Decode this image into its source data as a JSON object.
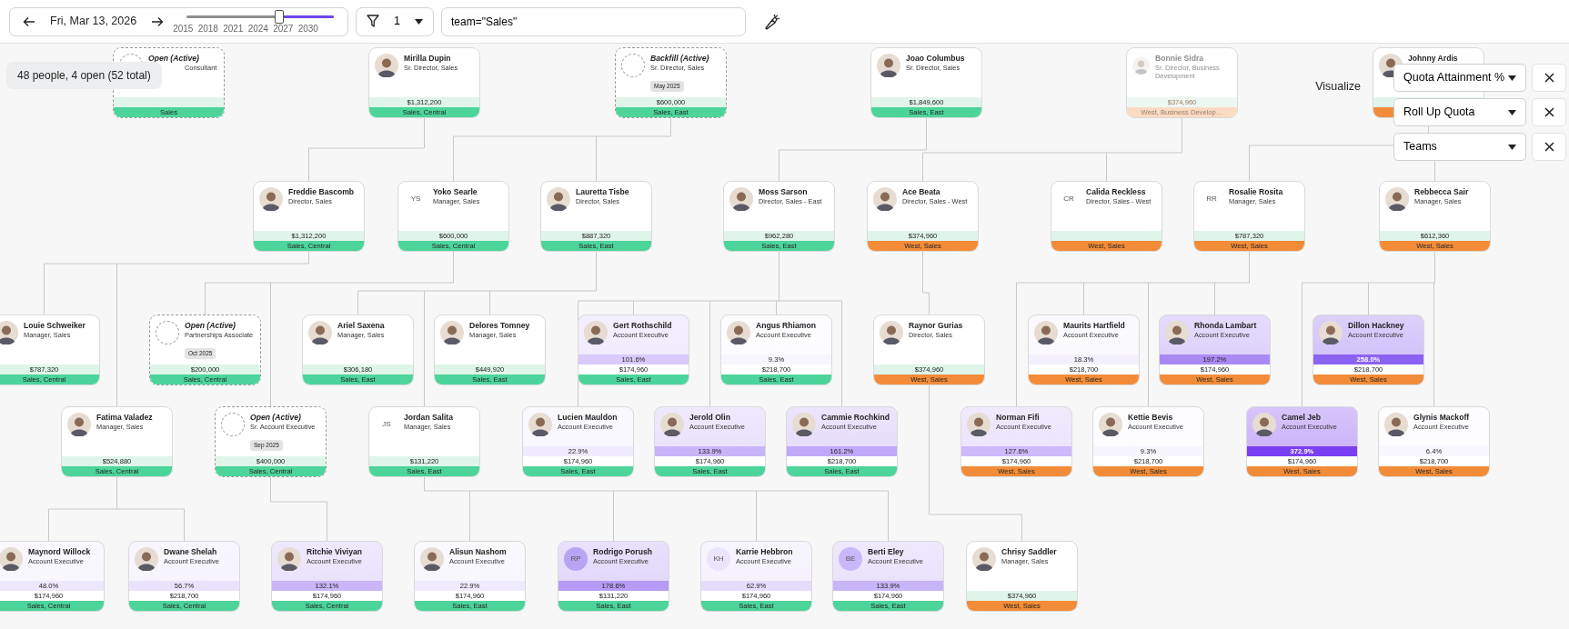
{
  "toolbar": {
    "date": "Fri, Mar 13, 2026",
    "slider": {
      "level": 0.63,
      "years": [
        "2015",
        "2018",
        "2021",
        "2024",
        "2027",
        "2030"
      ]
    },
    "filter": {
      "count": "1"
    },
    "query": {
      "value": "team=\"Sales\""
    }
  },
  "summary": "48 people, 4 open (52 total)",
  "visualize": {
    "label": "Visualize",
    "dropdowns": [
      {
        "label": "Quota Attainment %"
      },
      {
        "label": "Roll Up Quota"
      },
      {
        "label": "Teams"
      }
    ]
  },
  "cards": [
    {
      "kind": "open",
      "name": "Open (Active)",
      "title": "Consultant",
      "avatar": {
        "kind": "empty"
      },
      "team": {
        "text": "Sales",
        "color": "#4cd49b"
      }
    },
    {
      "kind": "person",
      "name": "Mirilla Dupin",
      "title": "Sr. Director, Sales",
      "avatar": {
        "kind": "photo"
      },
      "amount": "$1,312,200",
      "team": {
        "text": "Sales, Central",
        "color": "#4cd49b"
      }
    },
    {
      "kind": "open",
      "name": "Backfill (Active)",
      "title": "Sr. Director, Sales",
      "date": "May 2025",
      "avatar": {
        "kind": "empty"
      },
      "amount": "$600,000",
      "team": {
        "text": "Sales, East",
        "color": "#4cd49b"
      }
    },
    {
      "kind": "person",
      "name": "Joao Columbus",
      "title": "Sr. Director, Sales",
      "avatar": {
        "kind": "photo"
      },
      "amount": "$1,849,600",
      "team": {
        "text": "Sales, East",
        "color": "#4cd49b"
      }
    },
    {
      "kind": "person",
      "name": "Bonnie Sidra",
      "title": "Sr. Director, Business Development",
      "faded": true,
      "avatar": {
        "kind": "photo"
      },
      "amount": "$374,960",
      "team": {
        "text": "West, Business Develop…",
        "color": "#fbdcc3"
      }
    },
    {
      "kind": "person",
      "name": "Johnny Ardis",
      "avatar": {
        "kind": "photo"
      },
      "team": {
        "color": "#f28c38"
      }
    },
    {
      "kind": "person",
      "name": "Freddie Bascomb",
      "title": "Director, Sales",
      "avatar": {
        "kind": "photo"
      },
      "amount": "$1,312,200",
      "team": {
        "text": "Sales, Central",
        "color": "#4cd49b"
      }
    },
    {
      "kind": "person",
      "name": "Yoko Searle",
      "title": "Manager, Sales",
      "avatar": {
        "kind": "initials",
        "text": "YS"
      },
      "amount": "$600,000",
      "team": {
        "text": "Sales, Central",
        "color": "#4cd49b"
      }
    },
    {
      "kind": "person",
      "name": "Lauretta Tisbe",
      "title": "Director, Sales",
      "avatar": {
        "kind": "photo"
      },
      "amount": "$887,320",
      "team": {
        "text": "Sales, East",
        "color": "#4cd49b"
      }
    },
    {
      "kind": "person",
      "name": "Moss Sarson",
      "title": "Director, Sales - East",
      "avatar": {
        "kind": "photo"
      },
      "amount": "$962,280",
      "team": {
        "text": "Sales, East",
        "color": "#4cd49b"
      }
    },
    {
      "kind": "person",
      "name": "Ace Beata",
      "title": "Director, Sales - West",
      "avatar": {
        "kind": "photo"
      },
      "amount": "$374,960",
      "team": {
        "text": "West, Sales",
        "color": "#f28c38"
      }
    },
    {
      "kind": "person",
      "name": "Calida Reckless",
      "title": "Director, Sales - West",
      "avatar": {
        "kind": "initials",
        "text": "CR"
      },
      "team": {
        "text": "West, Sales",
        "color": "#f28c38"
      }
    },
    {
      "kind": "person",
      "name": "Rosalie Rosita",
      "title": "Manager, Sales",
      "avatar": {
        "kind": "initials",
        "text": "RR"
      },
      "amount": "$787,320",
      "team": {
        "text": "West, Sales",
        "color": "#f28c38"
      }
    },
    {
      "kind": "person",
      "name": "Rebbecca Sair",
      "title": "Manager, Sales",
      "avatar": {
        "kind": "photo"
      },
      "amount": "$612,360",
      "team": {
        "text": "West, Sales",
        "color": "#f28c38"
      }
    },
    {
      "kind": "person",
      "name": "Louie Schweiker",
      "title": "Manager, Sales",
      "avatar": {
        "kind": "photo"
      },
      "amount": "$787,320",
      "team": {
        "text": "Sales, Central",
        "color": "#4cd49b"
      }
    },
    {
      "kind": "open",
      "name": "Open (Active)",
      "title": "Partnerships Associate",
      "date": "Oct 2025",
      "avatar": {
        "kind": "empty"
      },
      "amount": "$200,000",
      "team": {
        "text": "Sales, Central",
        "color": "#4cd49b"
      }
    },
    {
      "kind": "person",
      "name": "Ariel Saxena",
      "title": "Manager, Sales",
      "avatar": {
        "kind": "photo"
      },
      "amount": "$306,180",
      "team": {
        "text": "Sales, East",
        "color": "#4cd49b"
      }
    },
    {
      "kind": "person",
      "name": "Delores Tomney",
      "title": "Manager, Sales",
      "avatar": {
        "kind": "photo"
      },
      "amount": "$449,920",
      "team": {
        "text": "Sales, East",
        "color": "#4cd49b"
      }
    },
    {
      "kind": "person",
      "name": "Gert Rothschild",
      "title": "Account Executive",
      "avatar": {
        "kind": "photo"
      },
      "attainment": {
        "text": "101.6%",
        "color": "#d9cafb"
      },
      "amount": "$174,960",
      "team": {
        "text": "Sales, East",
        "color": "#4cd49b"
      }
    },
    {
      "kind": "person",
      "name": "Angus Rhiamon",
      "title": "Account Executive",
      "avatar": {
        "kind": "photo"
      },
      "attainment": {
        "text": "9.3%",
        "color": "#f7f5fe"
      },
      "amount": "$218,700",
      "team": {
        "text": "Sales, East",
        "color": "#4cd49b"
      }
    },
    {
      "kind": "person",
      "name": "Raynor Gurias",
      "title": "Director, Sales",
      "avatar": {
        "kind": "photo"
      },
      "amount": "$374,960",
      "team": {
        "text": "West, Sales",
        "color": "#f28c38"
      }
    },
    {
      "kind": "person",
      "name": "Maurits Hartfield",
      "title": "Account Executive",
      "avatar": {
        "kind": "photo"
      },
      "attainment": {
        "text": "18.3%",
        "color": "#f3effd"
      },
      "amount": "$218,700",
      "team": {
        "text": "West, Sales",
        "color": "#f28c38"
      }
    },
    {
      "kind": "person",
      "name": "Rhonda Lambart",
      "title": "Account Executive",
      "avatar": {
        "kind": "photo"
      },
      "attainment": {
        "text": "197.2%",
        "color": "#a98af5"
      },
      "amount": "$174,960",
      "team": {
        "text": "West, Sales",
        "color": "#f28c38"
      }
    },
    {
      "kind": "person",
      "name": "Dillon Hackney",
      "title": "Account Executive",
      "avatar": {
        "kind": "photo"
      },
      "attainment": {
        "text": "258.0%",
        "color": "#8b63f3"
      },
      "amount": "$218,700",
      "team": {
        "text": "West, Sales",
        "color": "#f28c38"
      }
    },
    {
      "kind": "person",
      "name": "Fatima Valadez",
      "title": "Manager, Sales",
      "avatar": {
        "kind": "photo"
      },
      "amount": "$524,880",
      "team": {
        "text": "Sales, Central",
        "color": "#4cd49b"
      }
    },
    {
      "kind": "open",
      "name": "Open (Active)",
      "title": "Sr. Account Executive",
      "date": "Sep 2025",
      "avatar": {
        "kind": "empty"
      },
      "amount": "$400,000",
      "team": {
        "text": "Sales, Central",
        "color": "#4cd49b"
      }
    },
    {
      "kind": "person",
      "name": "Jordan Salita",
      "title": "Manager, Sales",
      "avatar": {
        "kind": "initials",
        "text": "JS"
      },
      "amount": "$131,220",
      "team": {
        "text": "Sales, East",
        "color": "#4cd49b"
      }
    },
    {
      "kind": "person",
      "name": "Lucien Mauldon",
      "title": "Account Executive",
      "avatar": {
        "kind": "photo"
      },
      "attainment": {
        "text": "22.9%",
        "color": "#efeafd"
      },
      "amount": "$174,960",
      "team": {
        "text": "Sales, East",
        "color": "#4cd49b"
      }
    },
    {
      "kind": "person",
      "name": "Jerold Olin",
      "title": "Account Executive",
      "avatar": {
        "kind": "photo"
      },
      "attainment": {
        "text": "133.9%",
        "color": "#c8b4f8"
      },
      "amount": "$174,960",
      "team": {
        "text": "Sales, East",
        "color": "#4cd49b"
      }
    },
    {
      "kind": "person",
      "name": "Cammie Rochkind",
      "title": "Account Executive",
      "avatar": {
        "kind": "photo"
      },
      "attainment": {
        "text": "161.2%",
        "color": "#c0a9f8"
      },
      "amount": "$218,700",
      "team": {
        "text": "Sales, East",
        "color": "#4cd49b"
      }
    },
    {
      "kind": "person",
      "name": "Norman Fifi",
      "title": "Account Executive",
      "avatar": {
        "kind": "photo"
      },
      "attainment": {
        "text": "127.6%",
        "color": "#cdbaf9"
      },
      "amount": "$174,960",
      "team": {
        "text": "West, Sales",
        "color": "#f28c38"
      }
    },
    {
      "kind": "person",
      "name": "Kettie Bevis",
      "title": "Account Executive",
      "avatar": {
        "kind": "photo"
      },
      "attainment": {
        "text": "9.3%",
        "color": "#f7f5fe"
      },
      "amount": "$218,700",
      "team": {
        "text": "West, Sales",
        "color": "#f28c38"
      }
    },
    {
      "kind": "person",
      "name": "Camel Jeb",
      "title": "Account Executive",
      "avatar": {
        "kind": "photo"
      },
      "attainment": {
        "text": "372.9%",
        "color": "#7a3ff2"
      },
      "amount": "$174,960",
      "team": {
        "text": "West, Sales",
        "color": "#f28c38"
      }
    },
    {
      "kind": "person",
      "name": "Glynis Mackoff",
      "title": "Account Executive",
      "avatar": {
        "kind": "photo"
      },
      "attainment": {
        "text": "6.4%",
        "color": "#f8f6fe"
      },
      "amount": "$218,700",
      "team": {
        "text": "West, Sales",
        "color": "#f28c38"
      }
    },
    {
      "kind": "person",
      "name": "Maynord Willock",
      "title": "Account Executive",
      "avatar": {
        "kind": "photo"
      },
      "attainment": {
        "text": "48.0%",
        "color": "#ede7fd"
      },
      "amount": "$174,960",
      "team": {
        "text": "Sales, Central",
        "color": "#4cd49b"
      }
    },
    {
      "kind": "person",
      "name": "Dwane Shelah",
      "title": "Account Executive",
      "avatar": {
        "kind": "photo"
      },
      "attainment": {
        "text": "56.7%",
        "color": "#e9e2fd"
      },
      "amount": "$218,700",
      "team": {
        "text": "Sales, Central",
        "color": "#4cd49b"
      }
    },
    {
      "kind": "person",
      "name": "Ritchie Viviyan",
      "title": "Account Executive",
      "avatar": {
        "kind": "photo"
      },
      "attainment": {
        "text": "132.1%",
        "color": "#c9b5f8"
      },
      "amount": "$174,960",
      "team": {
        "text": "Sales, Central",
        "color": "#4cd49b"
      }
    },
    {
      "kind": "person",
      "name": "Alisun Nashom",
      "title": "Account Executive",
      "avatar": {
        "kind": "photo"
      },
      "attainment": {
        "text": "22.9%",
        "color": "#efeafd"
      },
      "amount": "$174,960",
      "team": {
        "text": "Sales, East",
        "color": "#4cd49b"
      }
    },
    {
      "kind": "person",
      "name": "Rodrigo Porush",
      "title": "Account Executive",
      "avatar": {
        "kind": "initials",
        "text": "RP",
        "color": "#b9a3f5"
      },
      "attainment": {
        "text": "178.6%",
        "color": "#b59bf6"
      },
      "amount": "$131,220",
      "team": {
        "text": "Sales, East",
        "color": "#4cd49b"
      }
    },
    {
      "kind": "person",
      "name": "Karrie Hebbron",
      "title": "Account Executive",
      "avatar": {
        "kind": "initials",
        "text": "KH",
        "color": "#ebe4fc"
      },
      "attainment": {
        "text": "62.9%",
        "color": "#e5dcfc"
      },
      "amount": "$174,960",
      "team": {
        "text": "Sales, East",
        "color": "#4cd49b"
      }
    },
    {
      "kind": "person",
      "name": "Berti Eley",
      "title": "Account Executive",
      "avatar": {
        "kind": "initials",
        "text": "BE",
        "color": "#c9b8f8"
      },
      "attainment": {
        "text": "133.9%",
        "color": "#c8b4f8"
      },
      "amount": "$174,960",
      "team": {
        "text": "Sales, East",
        "color": "#4cd49b"
      }
    },
    {
      "kind": "person",
      "name": "Chrisy Saddler",
      "title": "Manager, Sales",
      "avatar": {
        "kind": "photo"
      },
      "amount": "$374,960",
      "team": {
        "text": "West, Sales",
        "color": "#f28c38"
      }
    }
  ]
}
